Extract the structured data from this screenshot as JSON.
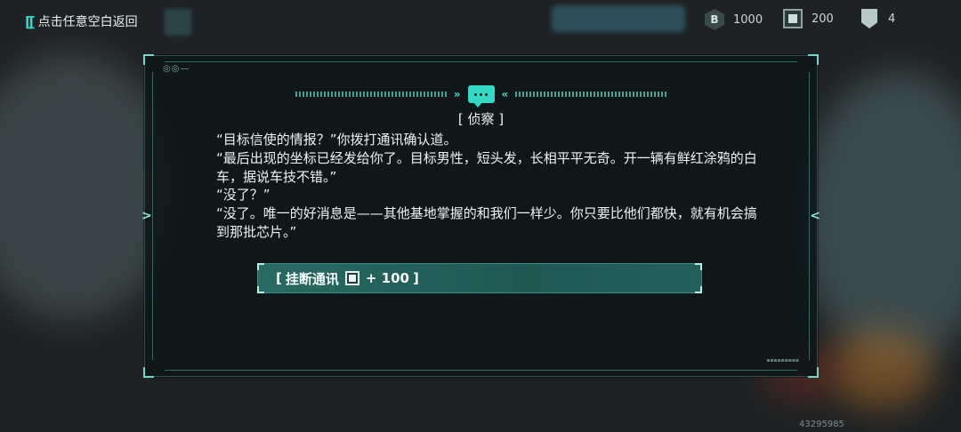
{
  "topbar": {
    "back_label": "点击任意空白返回",
    "resources": [
      {
        "icon": "b-coin-icon",
        "glyph": "B",
        "value": "1000"
      },
      {
        "icon": "chip-icon",
        "value": "200"
      },
      {
        "icon": "badge-icon",
        "value": "4"
      }
    ]
  },
  "dialog": {
    "title": "[ 侦察 ]",
    "lines": [
      "“目标信使的情报？”你拨打通讯确认道。",
      "“最后出现的坐标已经发给你了。目标男性，短头发，长相平平无奇。开一辆有鲜红涂鸦的白车，据说车技不错。”",
      "“没了？”",
      "“没了。唯一的好消息是——其他基地掌握的和我们一样少。你只要比他们都快，就有机会搞到那批芯片。”"
    ],
    "option": {
      "prefix": "[",
      "label": "挂断通讯",
      "reward_icon": "chip-icon",
      "reward": "+ 100",
      "suffix": "]"
    }
  },
  "footer": {
    "uid": "43295985"
  },
  "colors": {
    "accent": "#34d8c4",
    "panel": "#0e1618",
    "option_bg": "#1f5852"
  }
}
